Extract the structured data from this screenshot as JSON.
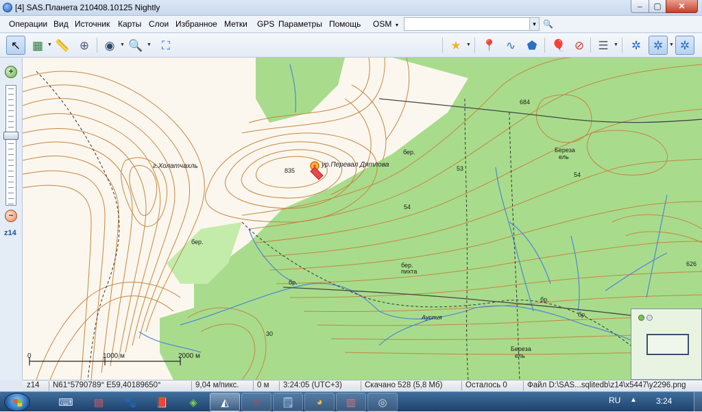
{
  "window": {
    "title": "[4] SAS.Планета 210408.10125 Nightly",
    "minimize_label": "–",
    "maximize_label": "▢",
    "close_label": "✕"
  },
  "menubar": {
    "items": [
      "Операции",
      "Вид",
      "Источник",
      "Карты",
      "Слои",
      "Избранное",
      "Метки",
      "GPS",
      "Параметры",
      "Помощь"
    ],
    "map_source": "OSM",
    "map_source_arrow": "▾",
    "search_value": "",
    "search_dropdown": "▾"
  },
  "toolbar": {
    "tools": [
      {
        "icon": "cursor-icon",
        "glyph": "↖",
        "active": true
      },
      {
        "icon": "select-region-icon",
        "glyph": "▦"
      },
      {
        "icon": "ruler-icon",
        "glyph": "📏"
      },
      {
        "icon": "compass-icon",
        "glyph": "⊕"
      },
      {
        "icon": "globe-icon",
        "glyph": "◉"
      },
      {
        "icon": "magnifier-icon",
        "glyph": "🔍"
      },
      {
        "icon": "fullscreen-icon",
        "glyph": "⛶"
      },
      {
        "icon": "favorites-star-icon",
        "glyph": "★"
      },
      {
        "icon": "add-placemark-icon",
        "glyph": "📍"
      },
      {
        "icon": "add-path-icon",
        "glyph": "∿"
      },
      {
        "icon": "add-polygon-icon",
        "glyph": "⬟"
      },
      {
        "icon": "placemarks-icon",
        "glyph": "🎈"
      },
      {
        "icon": "hide-placemarks-icon",
        "glyph": "⊘"
      },
      {
        "icon": "layers-icon",
        "glyph": "☰"
      },
      {
        "icon": "gps-icon",
        "glyph": "✲"
      },
      {
        "icon": "gps-track-icon",
        "glyph": "✲"
      },
      {
        "icon": "gps-center-icon",
        "glyph": "✲"
      }
    ]
  },
  "zoom": {
    "level_label": "z14",
    "in_label": "+",
    "out_label": "−"
  },
  "map": {
    "labels": {
      "place": "ур.Перевал Дятлова",
      "mountain": "г.Холатчахль",
      "elev_835": "835",
      "elev_684": "684",
      "elev_626": "626",
      "contour_54a": "54",
      "contour_54b": "54",
      "contour_53": "53",
      "contour_30": "30",
      "birch1": "Береза",
      "birch1b": "ель",
      "birch2": "Береза",
      "birch2b": "ель",
      "ber1": "бер.",
      "ber2": "бер.",
      "ber3": "бер.",
      "pikhta": "пихта",
      "river": "Ауспия",
      "br1": "бр.",
      "br2": "бр.",
      "br3": "бр.",
      "scale_0": "0",
      "scale_1000": "1000 м",
      "scale_2000": "2000 м"
    }
  },
  "statusbar": {
    "zoom": "z14",
    "coords": "N61°5790789° E59,40189650°",
    "scale": "9,04 м/пикс.",
    "distance": "0 м",
    "time": "3:24:05 (UTC+3)",
    "downloaded": "Скачано 528 (5,8 Мб)",
    "remaining": "Осталось 0",
    "file": "Файл D:\\SAS...sqlitedb\\z14\\x5447\\y2296.png"
  },
  "taskbar": {
    "lang": "RU",
    "tray_arrow": "▲",
    "time": "3:24",
    "apps": [
      {
        "icon": "keyboard-icon",
        "glyph": "⌨"
      },
      {
        "icon": "archive-icon",
        "glyph": "▤"
      },
      {
        "icon": "gimp-icon",
        "glyph": "🐾"
      },
      {
        "icon": "book-icon",
        "glyph": "📕"
      },
      {
        "icon": "navigator-icon",
        "glyph": "◈"
      },
      {
        "icon": "sas-planet-icon",
        "glyph": "◭"
      },
      {
        "icon": "opera-icon",
        "glyph": "○"
      },
      {
        "icon": "notepad-icon",
        "glyph": "🗒"
      },
      {
        "icon": "chrome-icon",
        "glyph": "◕"
      },
      {
        "icon": "winrar-icon",
        "glyph": "▥"
      },
      {
        "icon": "gamepad-icon",
        "glyph": "◎"
      }
    ]
  },
  "colors": {
    "forest": "#a8dc8c",
    "forest_light": "#c3ebaa",
    "contour": "#c5853f",
    "water": "#4a86d6",
    "taskbar": "#1f426d"
  }
}
